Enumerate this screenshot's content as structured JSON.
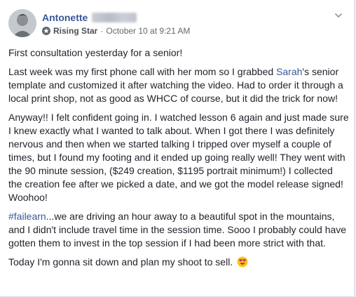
{
  "post": {
    "author": "Antonette",
    "badge": "Rising Star",
    "separator": "·",
    "timestamp": "October 10 at 9:21 AM",
    "para1": "First consultation yesterday for a senior!",
    "para2_a": "Last week was my first phone call with her mom so I grabbed ",
    "para2_link": "Sarah",
    "para2_b": "'s senior template and customized it after watching the video. Had to order it through a local print shop, not as good as WHCC of course, but it did the trick for now!",
    "para3": "Anyway!! I felt confident going in. I watched lesson 6 again and just made sure I knew exactly what I wanted to talk about. When I got there I was definitely nervous and then when we started talking I tripped over myself a couple of times, but I found my footing and it ended up going really well! They went with the 90 minute session, ($249 creation, $1195 portrait minimum!) I collected the creation fee after we picked a date, and we got the model release signed! Woohoo!",
    "para4_hashtag": "#failearn",
    "para4_rest": "...we are driving an hour away to a beautiful spot in the mountains, and I didn't include travel time in the session time. Sooo I probably could have gotten them to invest in the top session if I had been more strict with that.",
    "para5": "Today I'm gonna sit down and plan my shoot to sell.",
    "emoji_icon": "heart-eyes-emoji",
    "badge_icon": "star-badge-icon",
    "link_color": "#385898"
  }
}
